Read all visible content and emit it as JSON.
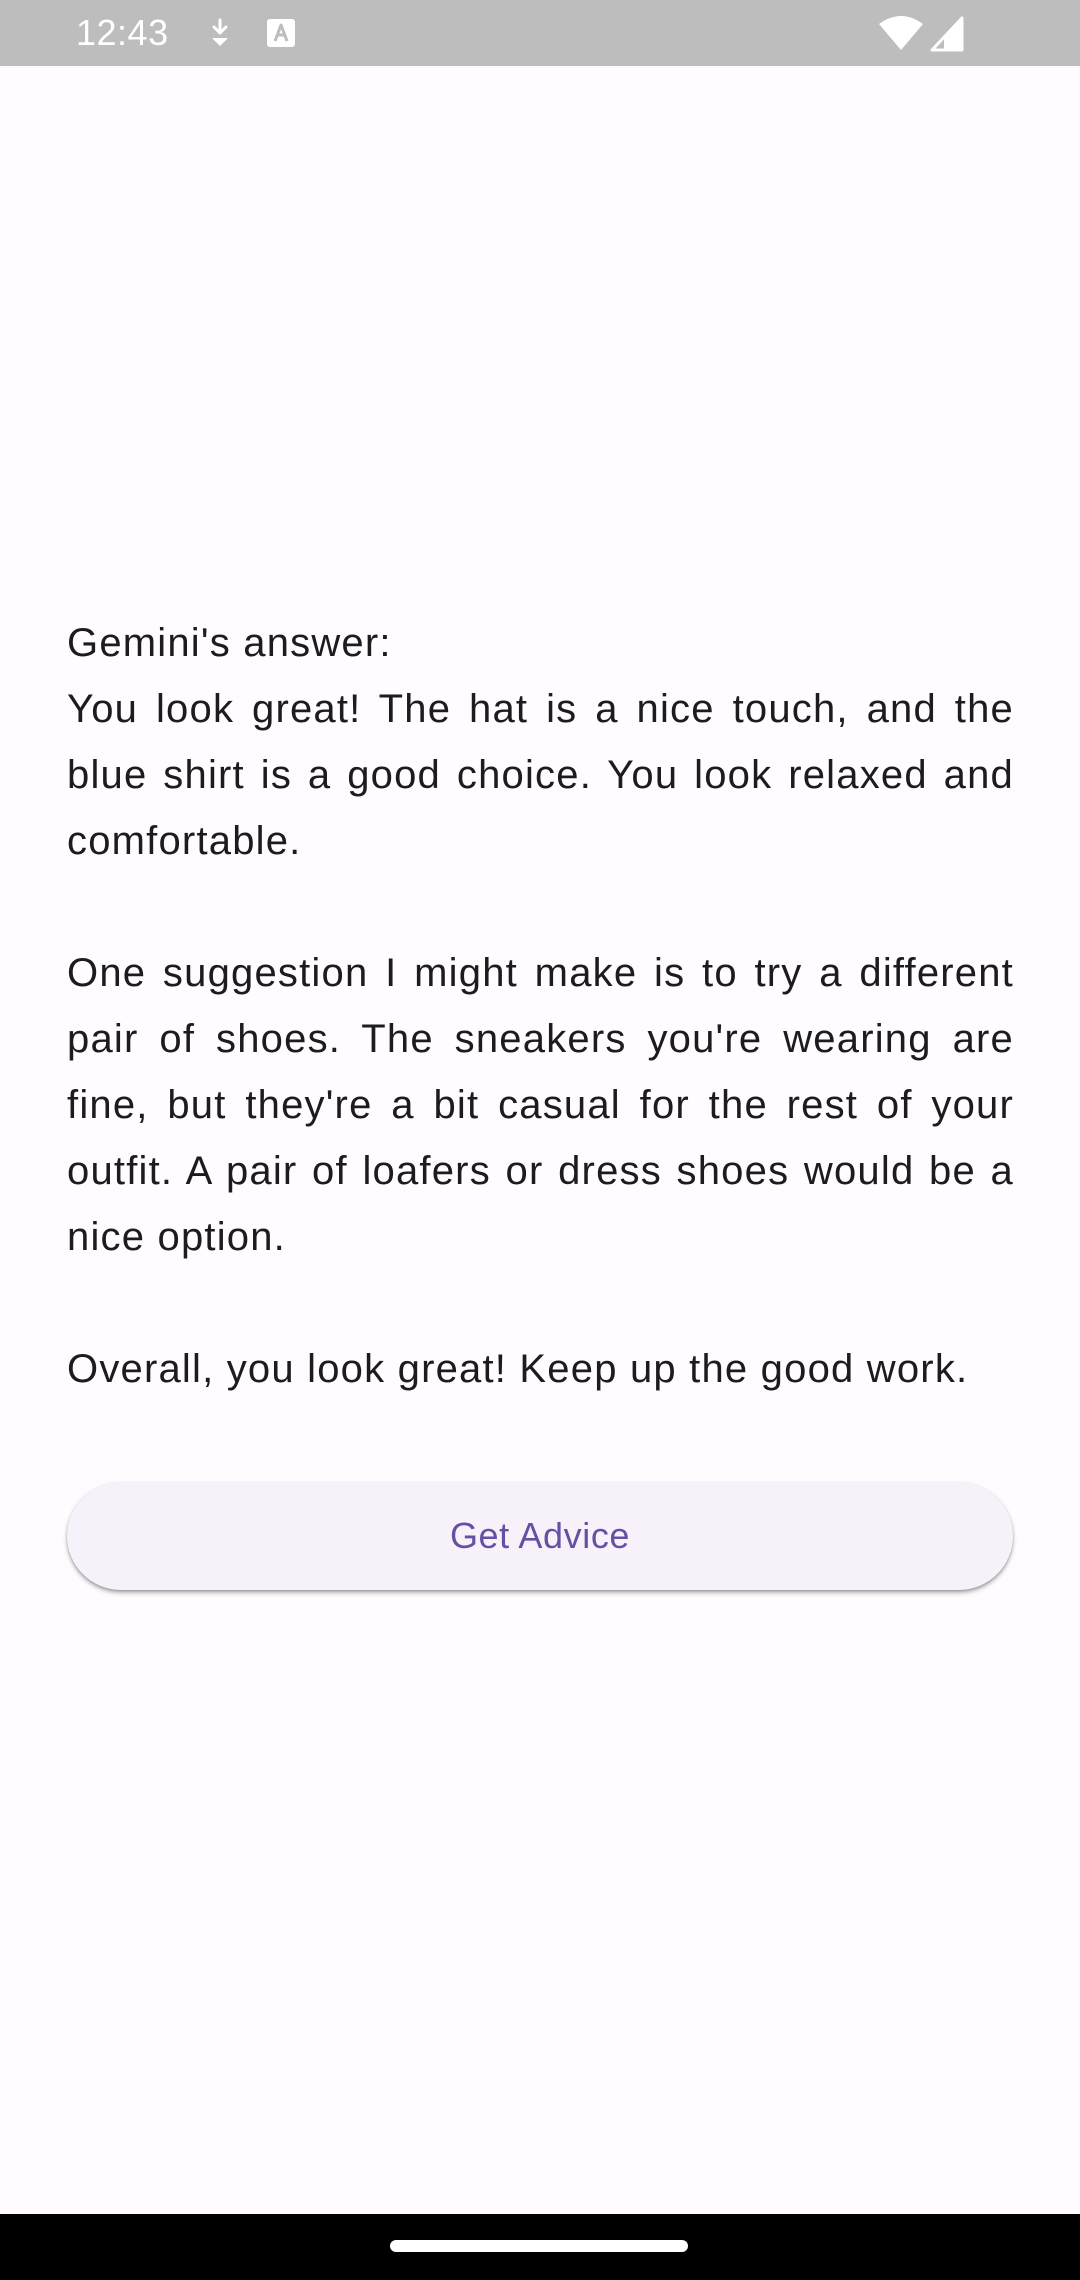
{
  "status_bar": {
    "time": "12:43",
    "icons": [
      "download-icon",
      "text-a-icon",
      "wifi-icon",
      "cell-signal-icon"
    ]
  },
  "answer": {
    "label": "Gemini's answer:",
    "paragraphs": [
      "You look great! The hat is a nice touch, and the blue shirt is a good choice. You look relaxed and comfortable.",
      "One suggestion I might make is to try a different pair of shoes. The sneakers you're wearing are fine, but they're a bit casual for the rest of your outfit. A pair of loafers or dress shoes would be a nice option.",
      "Overall, you look great! Keep up the good work."
    ]
  },
  "button": {
    "label": "Get Advice"
  },
  "colors": {
    "background": "#fffbfe",
    "text": "#1c1b1f",
    "button_bg": "#f7f2fa",
    "button_text": "#6750a4",
    "status_bar": "#bdbdbd",
    "nav_bar": "#000000"
  }
}
